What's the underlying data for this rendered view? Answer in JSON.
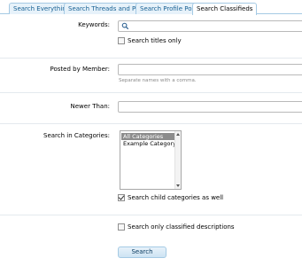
{
  "tabs": [
    {
      "label": "Search Everything"
    },
    {
      "label": "Search Threads and Posts"
    },
    {
      "label": "Search Profile Posts"
    },
    {
      "label": "Search Classifieds"
    }
  ],
  "form": {
    "keywords_label": "Keywords:",
    "keywords_value": "",
    "titles_only_label": "Search titles only",
    "titles_only_checked": false,
    "posted_by_label": "Posted by Member:",
    "posted_by_value": "",
    "posted_by_hint": "Separate names with a comma.",
    "newer_than_label": "Newer Than:",
    "newer_than_value": "",
    "categories_label": "Search in Categories:",
    "categories": [
      {
        "label": "All Categories",
        "selected": true
      },
      {
        "label": "Example Category",
        "selected": false
      }
    ],
    "child_categories_label": "Search child categories as well",
    "child_categories_checked": true,
    "descriptions_only_label": "Search only classified descriptions",
    "descriptions_only_checked": false,
    "submit_label": "Search"
  },
  "colors": {
    "accent": "#176093",
    "tab_border": "#a5cae4",
    "tab_bg": "#e7f2fa"
  }
}
